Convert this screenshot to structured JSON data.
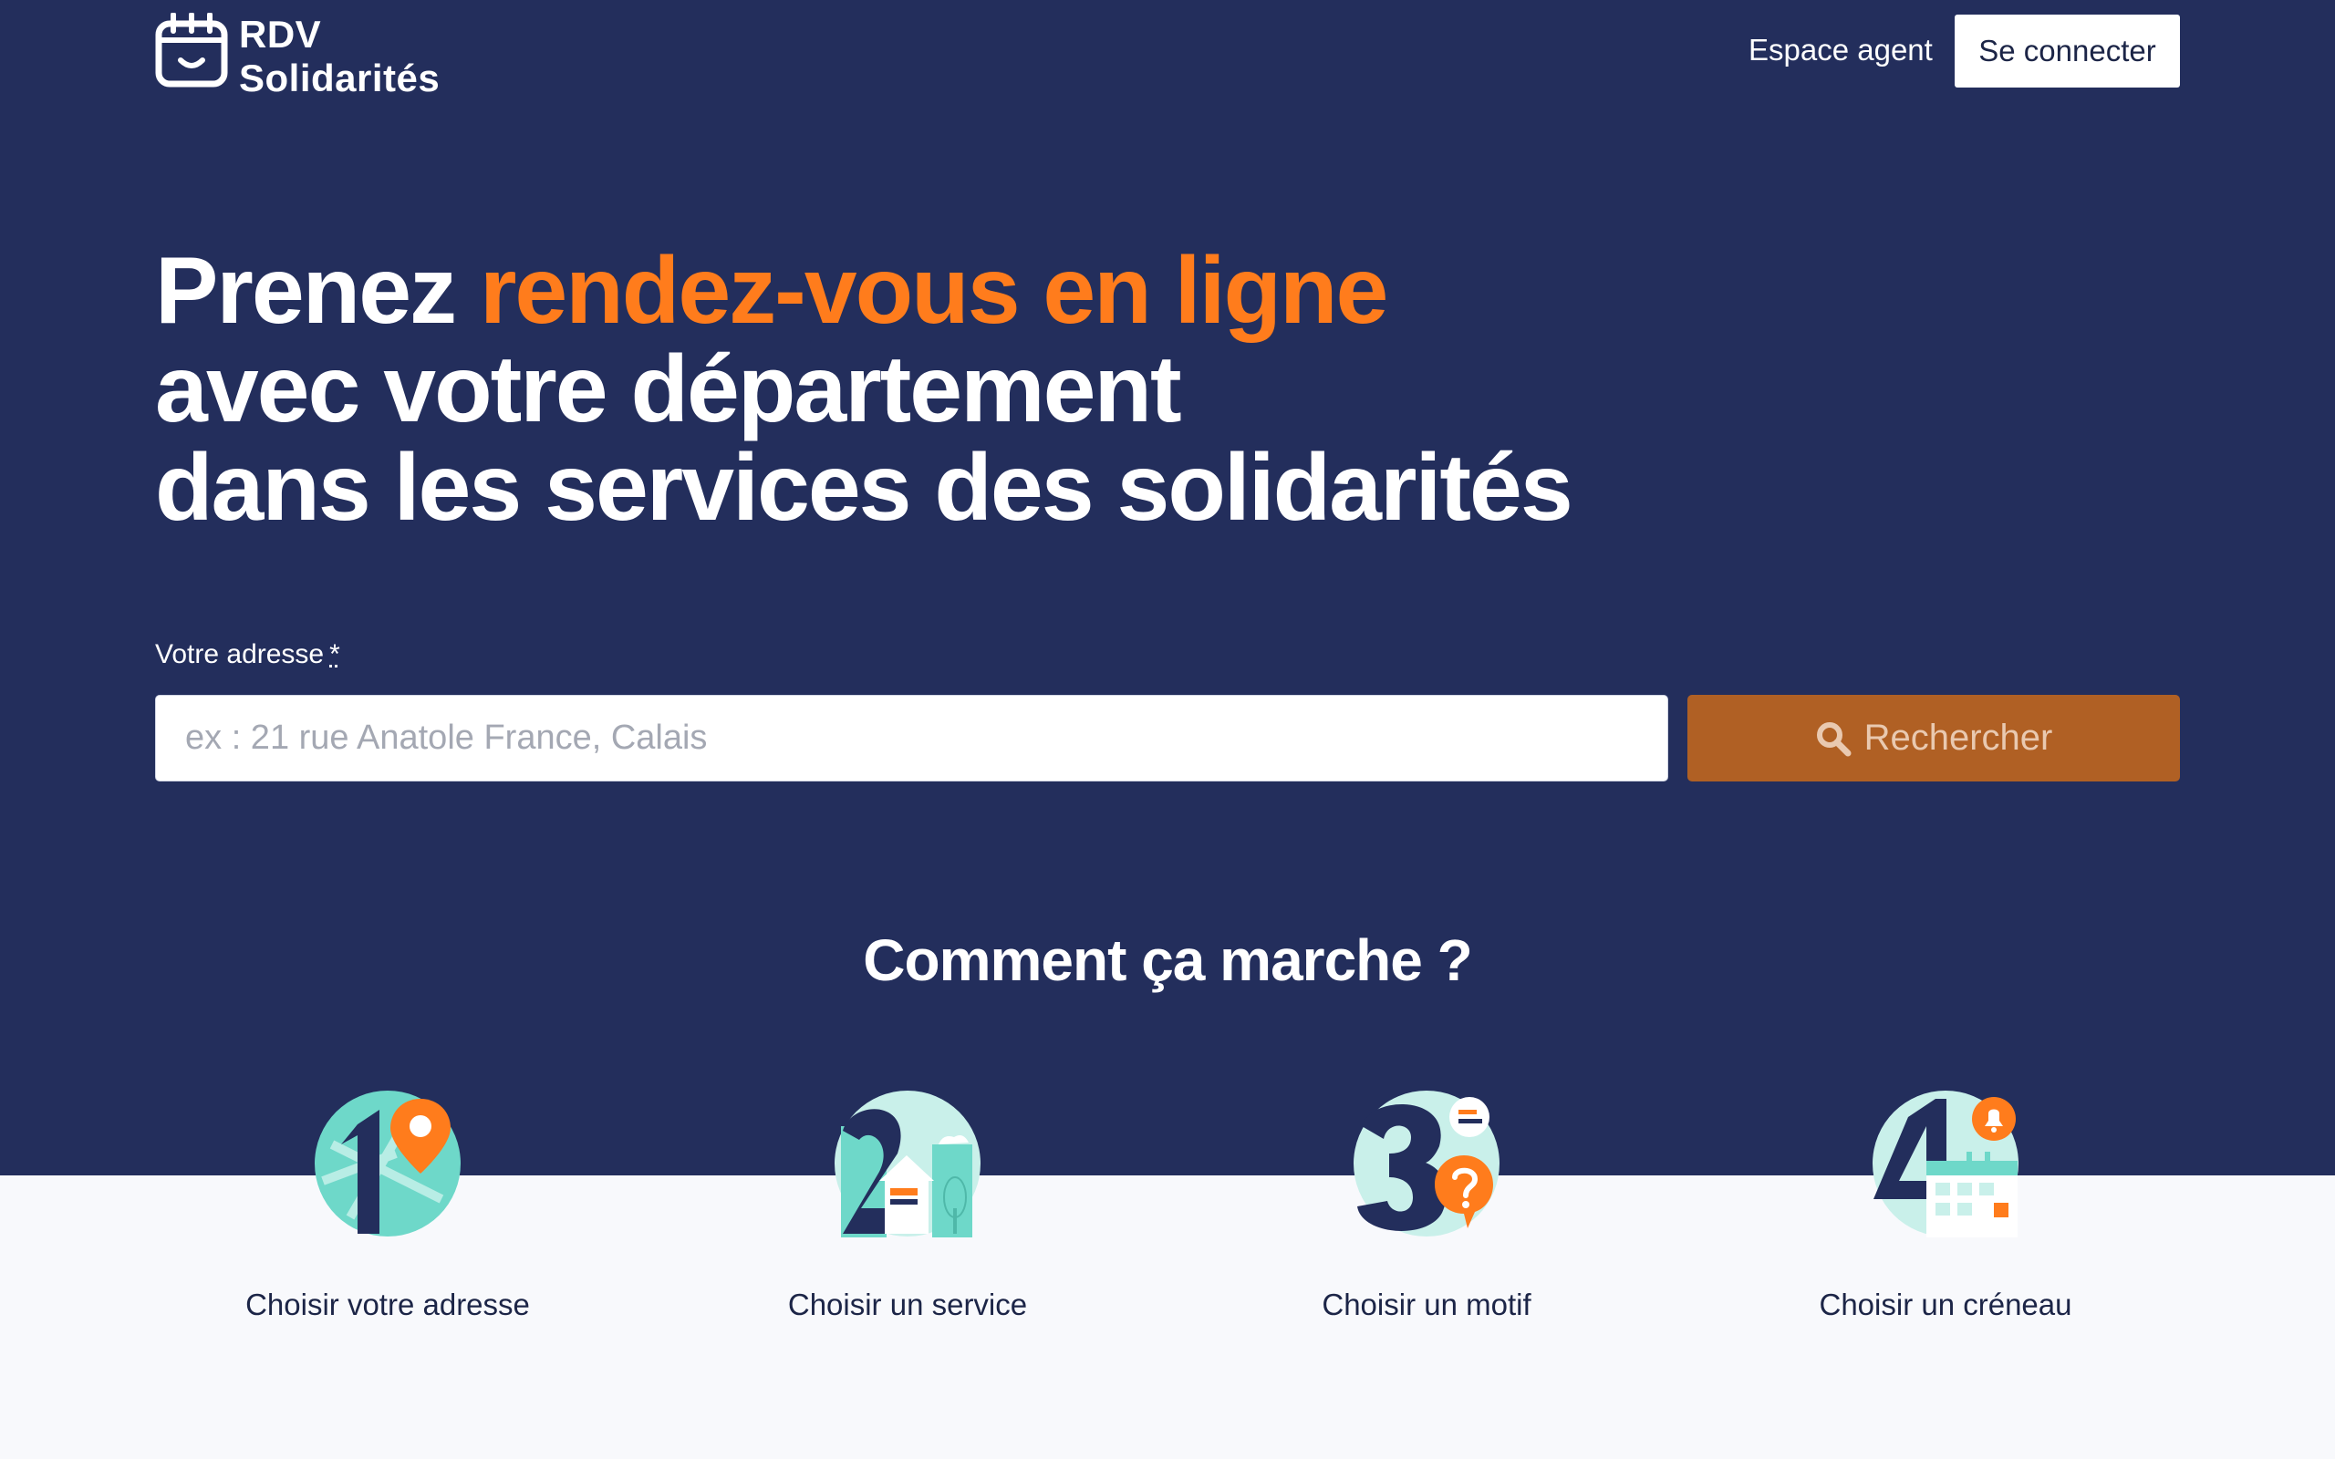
{
  "header": {
    "logo_line1": "RDV",
    "logo_line2": "Solidarités",
    "agent_link": "Espace agent",
    "connect_button": "Se connecter"
  },
  "hero": {
    "headline_part1": "Prenez ",
    "headline_accent": "rendez-vous en ligne",
    "headline_line2": "avec votre département",
    "headline_line3": "dans les services des solidarités"
  },
  "search": {
    "label": "Votre adresse",
    "required_mark": "*",
    "placeholder": "ex : 21 rue Anatole France, Calais",
    "value": "",
    "button_label": "Rechercher"
  },
  "how_it_works": {
    "title": "Comment ça marche ?",
    "steps": [
      {
        "number": "1",
        "label": "Choisir votre adresse",
        "icon": "map-pin-icon"
      },
      {
        "number": "2",
        "label": "Choisir un service",
        "icon": "building-icon"
      },
      {
        "number": "3",
        "label": "Choisir un motif",
        "icon": "question-bubble-icon"
      },
      {
        "number": "4",
        "label": "Choisir un créneau",
        "icon": "calendar-bell-icon"
      }
    ]
  },
  "colors": {
    "hero_bg": "#232e5c",
    "accent": "#ff7c1c",
    "search_button": "#b06024",
    "teal": "#6ed8c9",
    "page_bg": "#f8f9fc"
  }
}
